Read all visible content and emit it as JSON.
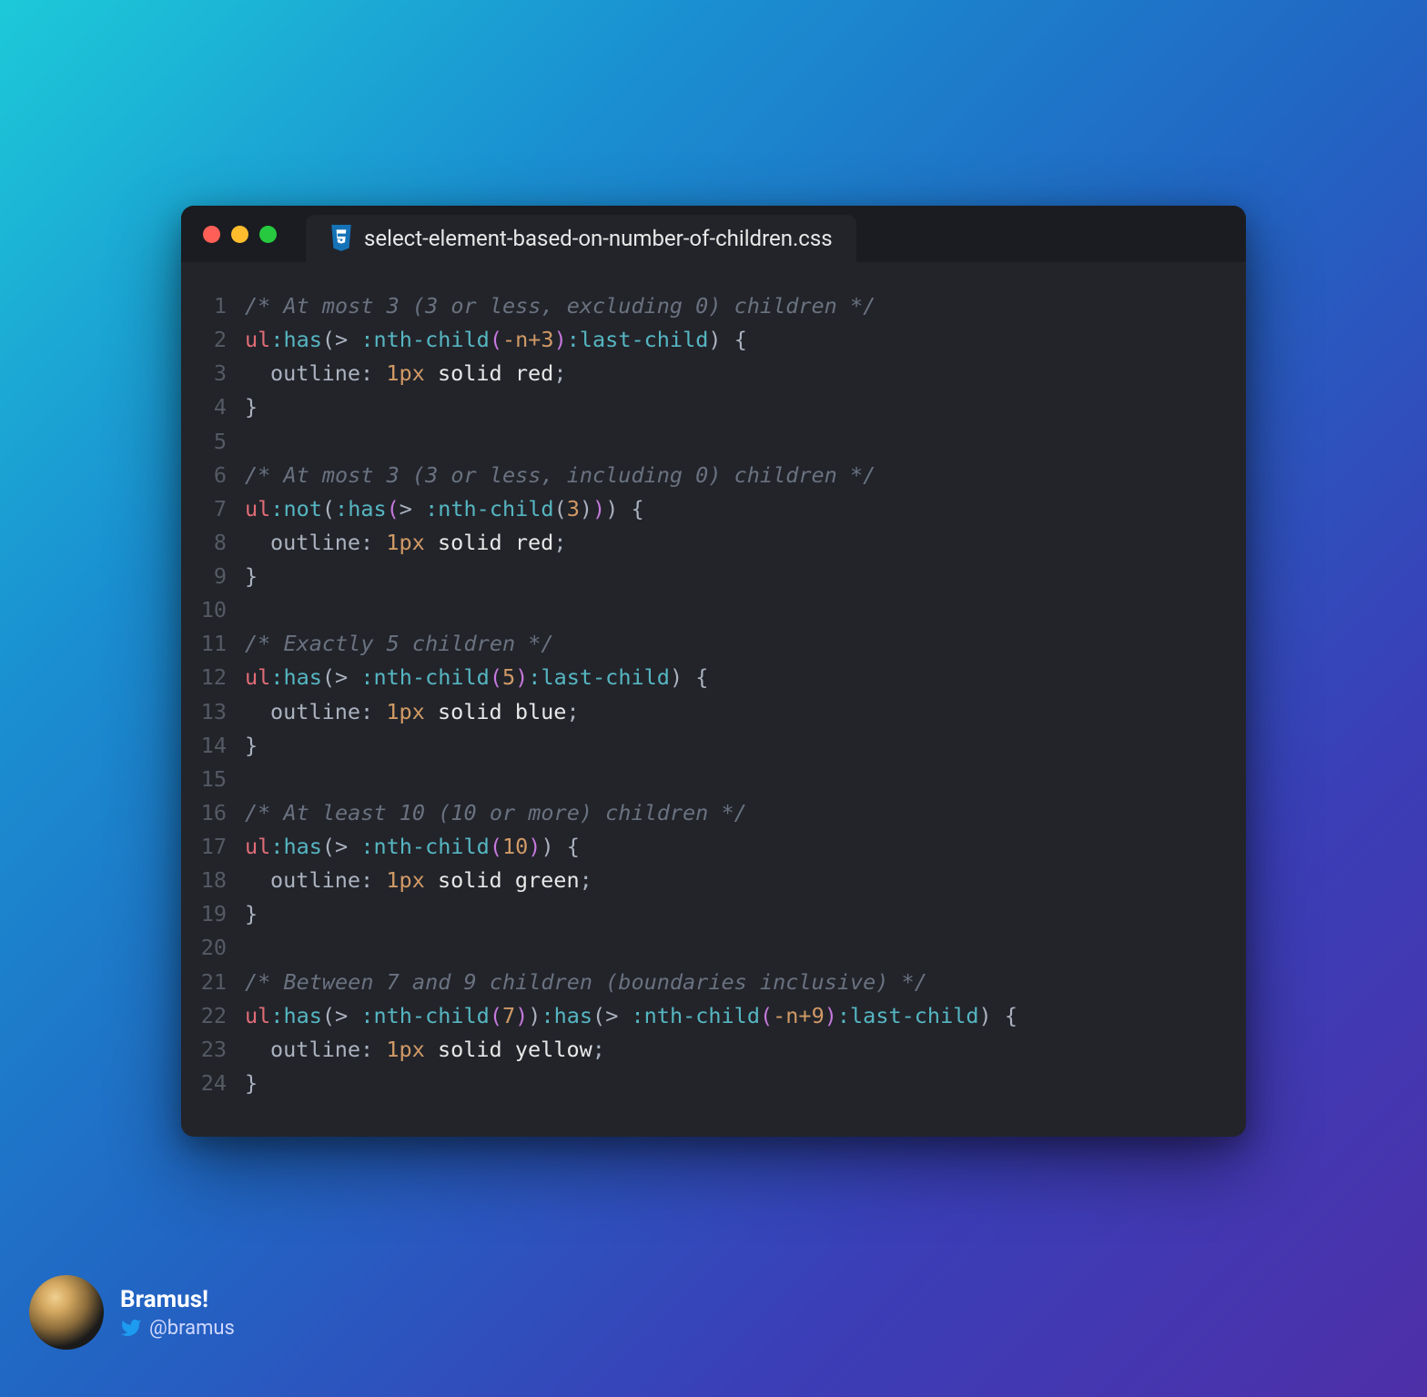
{
  "tab": {
    "filename": "select-element-based-on-number-of-children.css"
  },
  "code": {
    "comment1": "/* At most 3 (3 or less, excluding 0) children */",
    "line2": {
      "tag": "ul",
      "pseudo1": ":has",
      "gt": "> ",
      "pseudo2": ":nth-child",
      "arg": "-n+3",
      "pseudo3": ":last-child"
    },
    "line3": {
      "prop": "outline",
      "val_num": "1px",
      "val_solid": "solid",
      "val_color": "red"
    },
    "line4": {
      "brace": "}"
    },
    "comment2": "/* At most 3 (3 or less, including 0) children */",
    "line7": {
      "tag": "ul",
      "pseudo_not": ":not",
      "pseudo_has": ":has",
      "gt": "> ",
      "pseudo_nth": ":nth-child",
      "arg": "3"
    },
    "line8": {
      "prop": "outline",
      "val_num": "1px",
      "val_solid": "solid",
      "val_color": "red"
    },
    "line9": {
      "brace": "}"
    },
    "comment3": "/* Exactly 5 children */",
    "line12": {
      "tag": "ul",
      "pseudo1": ":has",
      "gt": "> ",
      "pseudo2": ":nth-child",
      "arg": "5",
      "pseudo3": ":last-child"
    },
    "line13": {
      "prop": "outline",
      "val_num": "1px",
      "val_solid": "solid",
      "val_color": "blue"
    },
    "line14": {
      "brace": "}"
    },
    "comment4": "/* At least 10 (10 or more) children */",
    "line17": {
      "tag": "ul",
      "pseudo1": ":has",
      "gt": "> ",
      "pseudo2": ":nth-child",
      "arg": "10"
    },
    "line18": {
      "prop": "outline",
      "val_num": "1px",
      "val_solid": "solid",
      "val_color": "green"
    },
    "line19": {
      "brace": "}"
    },
    "comment5": "/* Between 7 and 9 children (boundaries inclusive) */",
    "line22": {
      "tag": "ul",
      "pseudo1": ":has",
      "gt1": "> ",
      "pseudo_nth1": ":nth-child",
      "arg1": "7",
      "pseudo2": ":has",
      "gt2": "> ",
      "pseudo_nth2": ":nth-child",
      "arg2": "-n+9",
      "pseudo_last": ":last-child"
    },
    "line23": {
      "prop": "outline",
      "val_num": "1px",
      "val_solid": "solid",
      "val_color": "yellow"
    },
    "line24": {
      "brace": "}"
    }
  },
  "linenos": [
    "1",
    "2",
    "3",
    "4",
    "5",
    "6",
    "7",
    "8",
    "9",
    "10",
    "11",
    "12",
    "13",
    "14",
    "15",
    "16",
    "17",
    "18",
    "19",
    "20",
    "21",
    "22",
    "23",
    "24"
  ],
  "author": {
    "name": "Bramus!",
    "handle": "@bramus"
  }
}
